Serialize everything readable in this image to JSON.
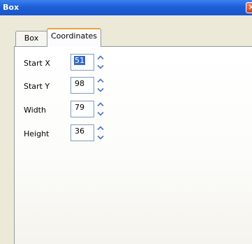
{
  "window": {
    "title": "Box",
    "close_glyph": "✕"
  },
  "tabs": [
    {
      "label": "Box",
      "active": false
    },
    {
      "label": "Coordinates",
      "active": true
    }
  ],
  "fields": [
    {
      "label": "Start X",
      "value": "51",
      "focused": true
    },
    {
      "label": "Start Y",
      "value": "98",
      "focused": false
    },
    {
      "label": "Width",
      "value": "79",
      "focused": false
    },
    {
      "label": "Height",
      "value": "36",
      "focused": false
    }
  ],
  "colors": {
    "titlebar": "#1d5fd8",
    "active_tab_highlight": "#e9a53a",
    "spin_arrow": "#4a72c8",
    "selection": "#316ac5"
  },
  "icons": {
    "spin_up": "spin-up-icon",
    "spin_down": "spin-down-icon"
  }
}
